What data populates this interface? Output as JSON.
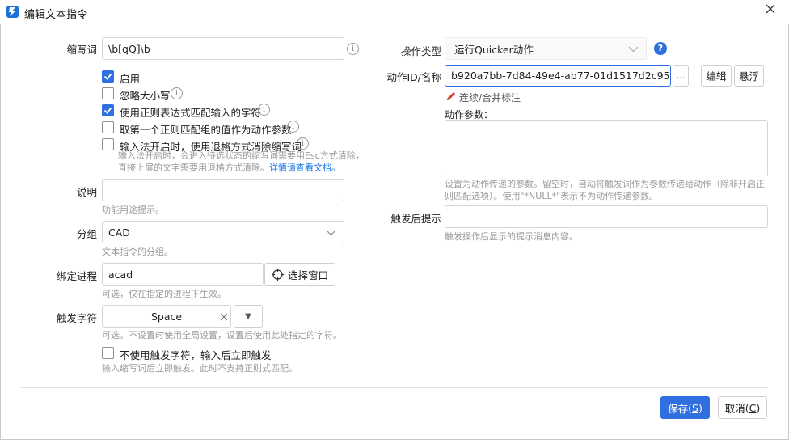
{
  "window": {
    "title": "编辑文本指令"
  },
  "left": {
    "abbr_label": "缩写词",
    "abbr_value": "\\b[qQ]\\b",
    "enable_label": "启用",
    "ignore_case_label": "忽略大小写",
    "use_regex_label": "使用正则表达式匹配输入的字符",
    "first_group_label": "取第一个正则匹配组的值作为动作参数",
    "ime_label": "输入法开启时，使用退格方式消除缩写词",
    "ime_hint_line1": "输入法开启时，会进入待选状态的缩写词需要用Esc方式清除，",
    "ime_hint_line2": "直接上屏的文字需要用退格方式清除。",
    "ime_hint_link": "详情请查看文档。",
    "desc_label": "说明",
    "desc_value": "",
    "desc_hint": "功能用途提示。",
    "group_label": "分组",
    "group_value": "CAD",
    "group_hint": "文本指令的分组。",
    "process_label": "绑定进程",
    "process_value": "acad",
    "select_window_label": "选择窗口",
    "process_hint": "可选，仅在指定的进程下生效。",
    "trigger_label": "触发字符",
    "trigger_value": "Space",
    "trigger_dropdown_glyph": "▼",
    "trigger_hint": "可选。不设置时使用全局设置，设置后使用此处指定的字符。",
    "no_trigger_label": "不使用触发字符，输入后立即触发",
    "no_trigger_hint": "输入缩写词后立即触发。此时不支持正则式匹配。"
  },
  "right": {
    "op_type_label": "操作类型",
    "op_type_value": "运行Quicker动作",
    "action_id_label": "动作ID/名称",
    "action_id_value": "b920a7bb-7d84-49e4-ab77-01d1517d2c95",
    "more_label": "...",
    "edit_label": "编辑",
    "float_label": "悬浮",
    "mark_link": "连续/合并标注",
    "params_label": "动作参数：",
    "params_value": "",
    "params_hint_line1": "设置为动作传递的参数。留空时，自动将触发词作为参数传递给动作（除非开启正",
    "params_hint_line2": "则匹配选项）。使用\"*NULL*\"表示不为动作传递参数。",
    "after_label": "触发后提示",
    "after_value": "",
    "after_hint": "触发操作后显示的提示消息内容。"
  },
  "footer": {
    "save_label": "保存",
    "save_key": "S",
    "cancel_label": "取消",
    "cancel_key": "C"
  },
  "colors": {
    "accent": "#2f6fe0",
    "hint": "#9a9a9a",
    "link": "#1a73e8",
    "pen": "#e03b24"
  }
}
